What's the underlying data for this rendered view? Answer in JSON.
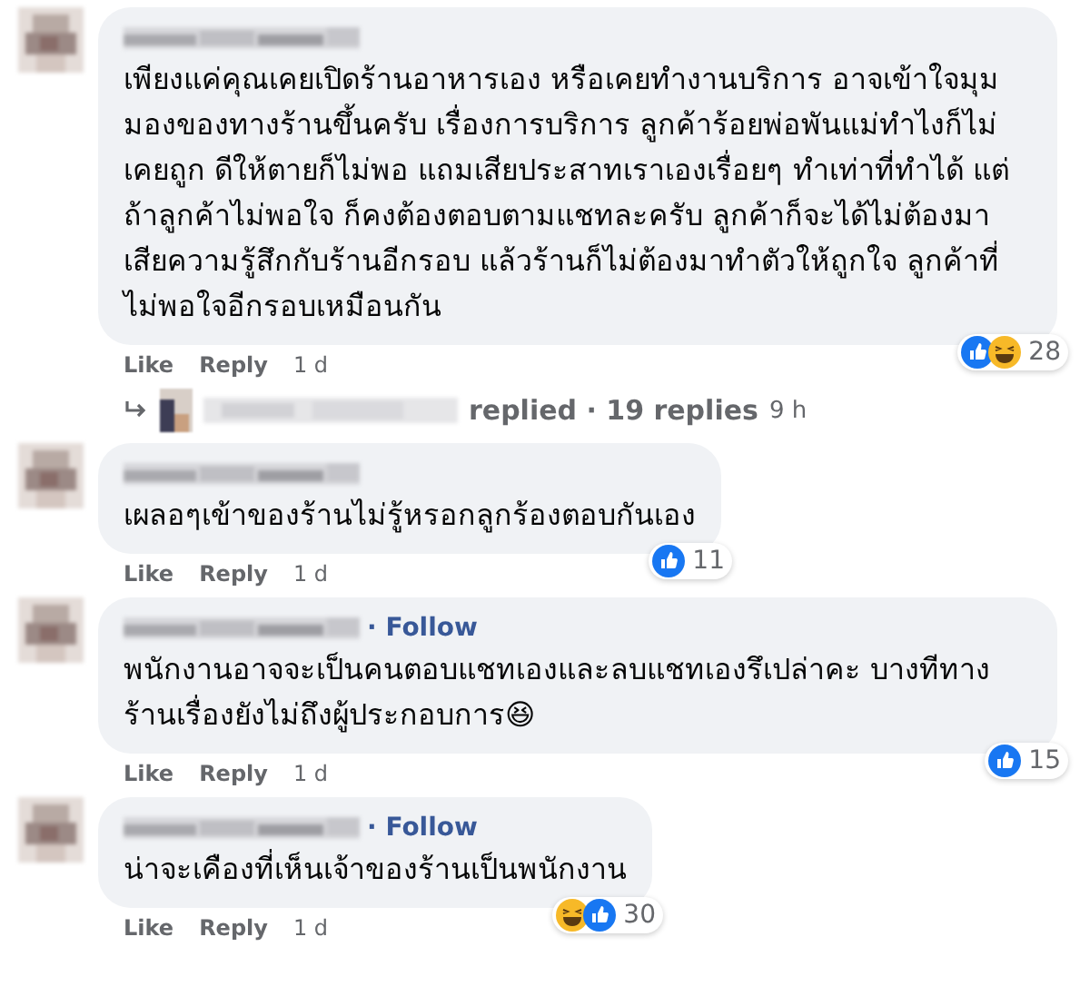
{
  "comments": [
    {
      "text": "เพียงแค่คุณเคยเปิดร้านอาหารเอง หรือเคยทำงานบริการ อาจเข้าใจมุมมองของทางร้านขึ้นครับ เรื่องการบริการ ลูกค้าร้อยพ่อพันแม่ทำไงก็ไม่เคยถูก ดีให้ตายก็ไม่พอ แถมเสียประสาทเราเองเรื่อยๆ ทำเท่าที่ทำได้ แต่ถ้าลูกค้าไม่พอใจ ก็คงต้องตอบตามแชทละครับ ลูกค้าก็จะได้ไม่ต้องมาเสียความรู้สึกกับร้านอีกรอบ แล้วร้านก็ไม่ต้องมาทำตัวให้ถูกใจ ลูกค้าที่ไม่พอใจอีกรอบเหมือนกัน",
      "reactions": [
        {
          "kind": "like"
        },
        {
          "kind": "haha"
        }
      ],
      "count": "28",
      "actions": [
        "Like",
        "Reply"
      ],
      "time": "1 d",
      "reply_summary": {
        "text": "replied · 19 replies",
        "time": "9 h"
      }
    },
    {
      "text": "เผลอๆเข้าของร้านไม่รู้หรอกลูกร้องตอบกันเอง",
      "reactions": [
        {
          "kind": "like"
        }
      ],
      "count": "11",
      "actions": [
        "Like",
        "Reply"
      ],
      "time": "1 d"
    },
    {
      "follow": "· Follow",
      "text": "พนักงานอาจจะเป็นคนตอบแชทเองและลบแชทเองรึเปล่าคะ บางทีทางร้านเรื่องยังไม่ถึงผู้ประกอบการ😆",
      "reactions": [
        {
          "kind": "like"
        }
      ],
      "count": "15",
      "actions": [
        "Like",
        "Reply"
      ],
      "time": "1 d"
    },
    {
      "follow": "· Follow",
      "text": "น่าจะเคืองที่เห็นเจ้าของร้านเป็นพนักงาน",
      "reactions": [
        {
          "kind": "haha"
        },
        {
          "kind": "like"
        }
      ],
      "count": "30",
      "actions": [
        "Like",
        "Reply"
      ],
      "time": "1 d"
    }
  ]
}
